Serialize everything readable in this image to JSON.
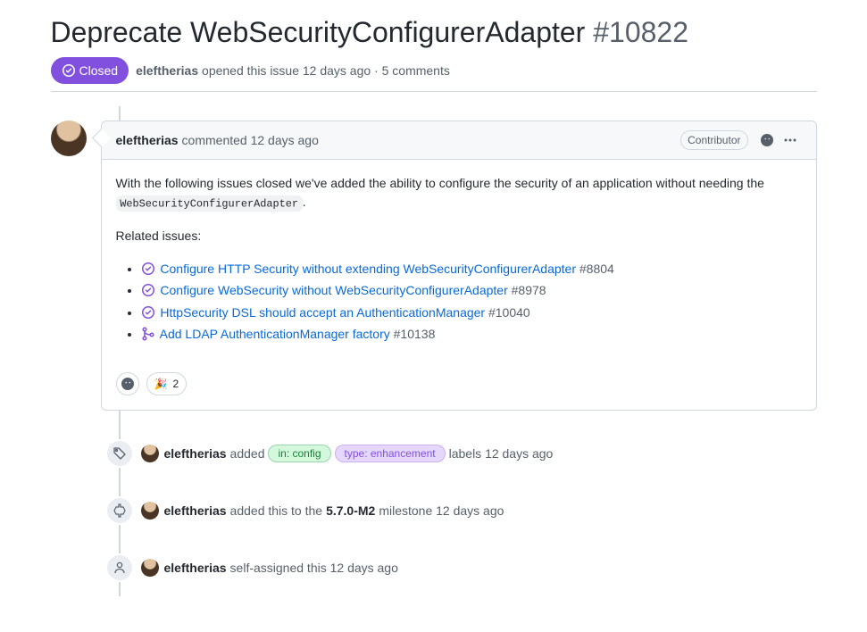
{
  "issue": {
    "title": "Deprecate WebSecurityConfigurerAdapter",
    "number": "#10822",
    "state": "Closed",
    "author": "eleftherias",
    "opened_text": "opened this issue 12 days ago · 5 comments"
  },
  "comment": {
    "author": "eleftherias",
    "commented_text": "commented 12 days ago",
    "association": "Contributor",
    "body_intro_pre": "With the following issues closed we've added the ability to configure the security of an application without needing the ",
    "body_code": "WebSecurityConfigurerAdapter",
    "body_intro_post": ".",
    "related_heading": "Related issues:",
    "items": [
      {
        "icon": "closed",
        "text": "Configure HTTP Security without extending WebSecurityConfigurerAdapter",
        "ref": "#8804"
      },
      {
        "icon": "closed",
        "text": "Configure WebSecurity without WebSecurityConfigurerAdapter",
        "ref": "#8978"
      },
      {
        "icon": "closed",
        "text": "HttpSecurity DSL should accept an AuthenticationManager",
        "ref": "#10040"
      },
      {
        "icon": "merge",
        "text": "Add LDAP AuthenticationManager factory",
        "ref": "#10138"
      }
    ],
    "reaction_emoji": "🎉",
    "reaction_count": "2"
  },
  "events": {
    "label": {
      "author": "eleftherias",
      "added_word": "added",
      "label1": "in: config",
      "label2": "type: enhancement",
      "suffix": "labels 12 days ago"
    },
    "milestone": {
      "author": "eleftherias",
      "pre": "added this to the",
      "milestone": "5.7.0-M2",
      "suffix": "milestone 12 days ago"
    },
    "assign": {
      "author": "eleftherias",
      "text": "self-assigned this 12 days ago"
    }
  }
}
